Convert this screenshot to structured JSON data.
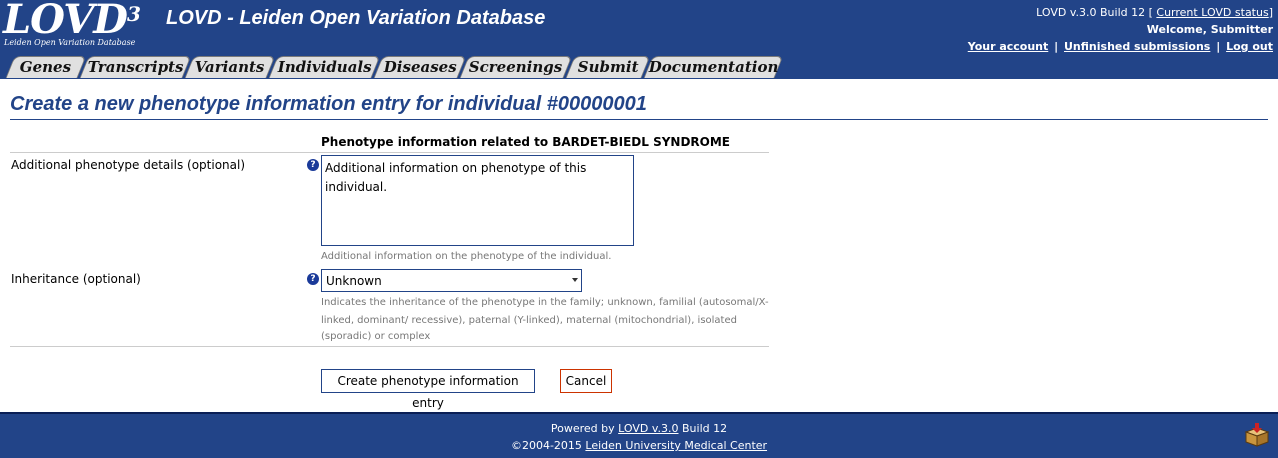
{
  "header": {
    "logo_text": "LOVD",
    "logo_sup": "3",
    "logo_sub": "Leiden Open Variation Database",
    "title": "LOVD - Leiden Open Variation Database",
    "version_text": "LOVD v.3.0 Build 12 [",
    "status_link": "Current LOVD status",
    "version_close": "]",
    "welcome": "Welcome, Submitter",
    "links": [
      "Your account",
      "Unfinished submissions",
      "Log out"
    ],
    "sep": "|"
  },
  "tabs": [
    "Genes",
    "Transcripts",
    "Variants",
    "Individuals",
    "Diseases",
    "Screenings",
    "Submit",
    "Documentation"
  ],
  "page": {
    "title": "Create a new phenotype information entry for individual #00000001"
  },
  "form": {
    "section_head": "Phenotype information related to BARDET-BIEDL SYNDROME",
    "help_glyph": "?",
    "details": {
      "label": "Additional phenotype details (optional)",
      "value": "Additional information on phenotype of this individual.",
      "hint": "Additional information on the phenotype of the individual."
    },
    "inheritance": {
      "label": "Inheritance (optional)",
      "value": "Unknown",
      "hint_lines": [
        "Indicates the inheritance of the phenotype in the family; unknown, familial (autosomal/X-",
        "linked, dominant/ recessive), paternal (Y-linked), maternal (mitochondrial), isolated",
        "(sporadic) or complex"
      ]
    },
    "submit_label": "Create phenotype information entry",
    "cancel_label": "Cancel"
  },
  "footer": {
    "powered_prefix": "Powered by ",
    "lovd_link": "LOVD v.3.0",
    "powered_suffix": " Build 12",
    "copyright_prefix": "©2004-2015 ",
    "lumc_link": "Leiden University Medical Center"
  },
  "colors": {
    "brand": "#224488",
    "tab_bg": "#e0e0e0",
    "cancel_border": "#cc3300"
  },
  "icons": {
    "help": "help-icon",
    "package": "package-icon"
  }
}
